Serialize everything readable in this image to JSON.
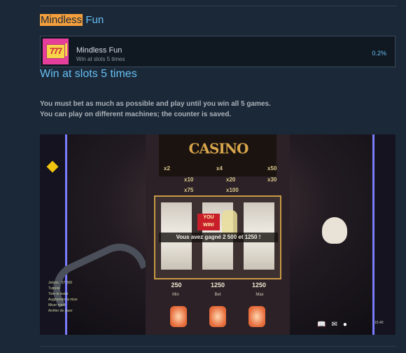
{
  "section": {
    "heading_highlight": "Mindless",
    "heading_rest": " Fun"
  },
  "achievement": {
    "icon": "slot-777-icon",
    "icon_text": "777",
    "name": "Mindless Fun",
    "description": "Win at slots 5 times",
    "percent": "0.2%"
  },
  "guide": {
    "title": "Win at slots 5 times",
    "lines": [
      "You must bet as much as possible and play until you win all 5 games.",
      "You can play on different machines; the counter is saved."
    ]
  },
  "screenshot": {
    "casino_title": "CASINO",
    "paytable": [
      "x2",
      "x4",
      "x50",
      "x10",
      "x20",
      "x30",
      "x75",
      "x100"
    ],
    "reel_values": [
      "250",
      "1250",
      "1250"
    ],
    "banner": "Vous avez gagné 2 500 et 1250 !",
    "you_win": "YOU WIN!",
    "buttons": [
      "Min",
      "Bet",
      "Max"
    ],
    "hud_lines": [
      "Jetons : 57 300",
      "Tutoriel",
      "Tirer le levier",
      "Augmenter la mise",
      "Miser maxi",
      "Arrêter de jouer"
    ],
    "time": "15:40"
  }
}
